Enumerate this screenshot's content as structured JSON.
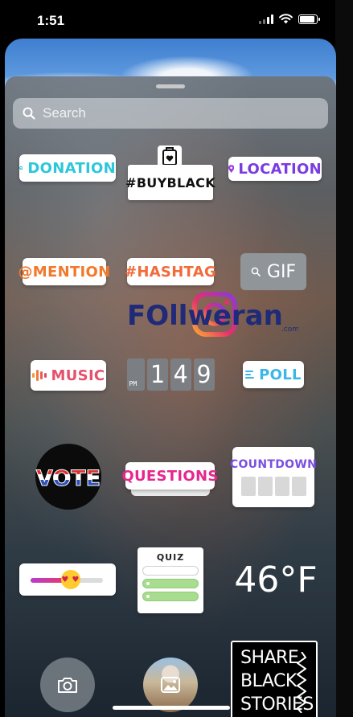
{
  "status_bar": {
    "time": "1:51",
    "battery_fraction": 0.9
  },
  "search": {
    "placeholder": "Search"
  },
  "stickers": {
    "donation": "DONATION",
    "buyblack": "#BUYBLACK",
    "location": "LOCATION",
    "mention": "@MENTION",
    "hashtag": "#HASHTAG",
    "gif": "GIF",
    "music": "MUSIC",
    "counter_digits": [
      "1",
      "4",
      "9"
    ],
    "poll": "POLL",
    "vote": "VOTE",
    "questions": "QUESTIONS",
    "countdown": "COUNTDOWN",
    "slider_value": 0.55,
    "quiz": "QUIZ",
    "temperature": "46°F",
    "share_lines": [
      "SHARE",
      "BLACK",
      "STORIES"
    ]
  },
  "watermark": {
    "brand": "FOllweran",
    "suffix": ".com"
  },
  "colors": {
    "donation": "#2dc7d8",
    "location": "#7a3be0",
    "mention": "#f2792b",
    "hashtag": "#f26b3a",
    "music": "#e6506a",
    "poll": "#3bb6e6",
    "questions": "#e5288e",
    "countdown": "#7b4fe0"
  },
  "icons": [
    "search-icon",
    "heart-icon",
    "location-pin-icon",
    "music-bars-icon",
    "poll-lines-icon",
    "camera-icon",
    "photo-icon"
  ]
}
